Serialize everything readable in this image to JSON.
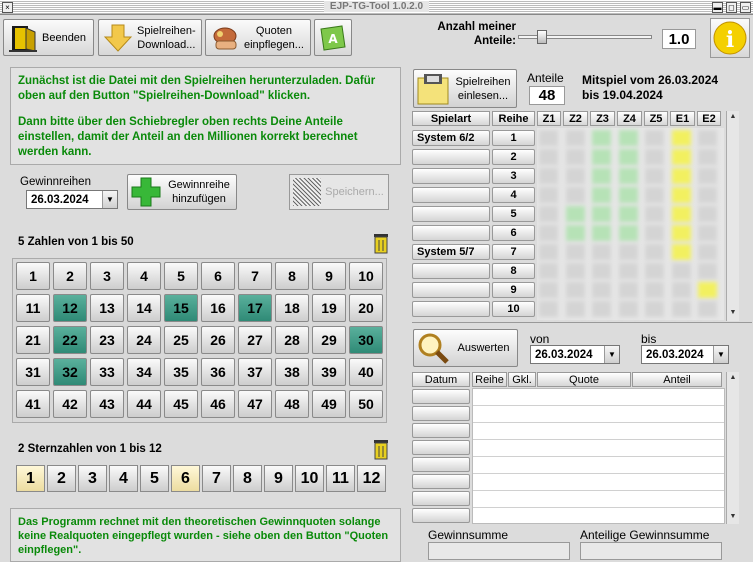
{
  "window": {
    "title": "EJP-TG-Tool 1.0.2.0"
  },
  "toolbar": {
    "quit": "Beenden",
    "download": "Spielreihen-\nDownload...",
    "quotes": "Quoten\neinpflegen..."
  },
  "shares": {
    "label": "Anzahl meiner\nAnteile:",
    "value": "1.0",
    "slider_fraction": 0.04
  },
  "intro": {
    "p1": "Zunächst ist die Datei mit den Spielreihen herunterzuladen. Dafür oben auf den Button \"Spielreihen-Download\" klicken.",
    "p2": "Dann bitte über den Schiebregler oben rechts Deine Anteile einstellen, damit der Anteil an den Millionen korrekt berechnet werden kann."
  },
  "winning": {
    "label": "Gewinnreihen",
    "date": "26.03.2024",
    "add": "Gewinnreihe\nhinzufügen",
    "save": "Speichern..."
  },
  "numbers": {
    "title": "5 Zahlen von 1 bis 50",
    "selected": [
      12,
      15,
      17,
      22,
      30,
      32
    ]
  },
  "stars": {
    "title": "2 Sternzahlen von 1 bis 12",
    "selected": [
      1,
      6
    ]
  },
  "footer": {
    "note": "Das Programm rechnet mit den theoretischen Gewinnquoten solange keine Realquoten eingepflegt wurden - siehe oben den Button \"Quoten einpflegen\"."
  },
  "rows": {
    "load": "Spielreihen\neinlesen...",
    "shares_label": "Anteile",
    "shares_count": "48",
    "period": "Mitspiel vom 26.03.2024\nbis 19.04.2024",
    "headers": [
      "Spielart",
      "Reihe",
      "Z1",
      "Z2",
      "Z3",
      "Z4",
      "Z5",
      "E1",
      "E2"
    ],
    "types": [
      "System 6/2",
      "",
      "",
      "",
      "",
      "",
      "System 5/7",
      "",
      "",
      ""
    ],
    "numbers": [
      "1",
      "2",
      "3",
      "4",
      "5",
      "6",
      "7",
      "8",
      "9",
      "10"
    ]
  },
  "evaluate": {
    "button": "Auswerten",
    "from_label": "von",
    "to_label": "bis",
    "from": "26.03.2024",
    "to": "26.03.2024",
    "headers": [
      "Datum",
      "Reihe",
      "Gkl.",
      "Quote",
      "Anteil"
    ]
  },
  "totals": {
    "sum": "Gewinnsumme",
    "share_sum": "Anteilige Gewinnsumme"
  }
}
